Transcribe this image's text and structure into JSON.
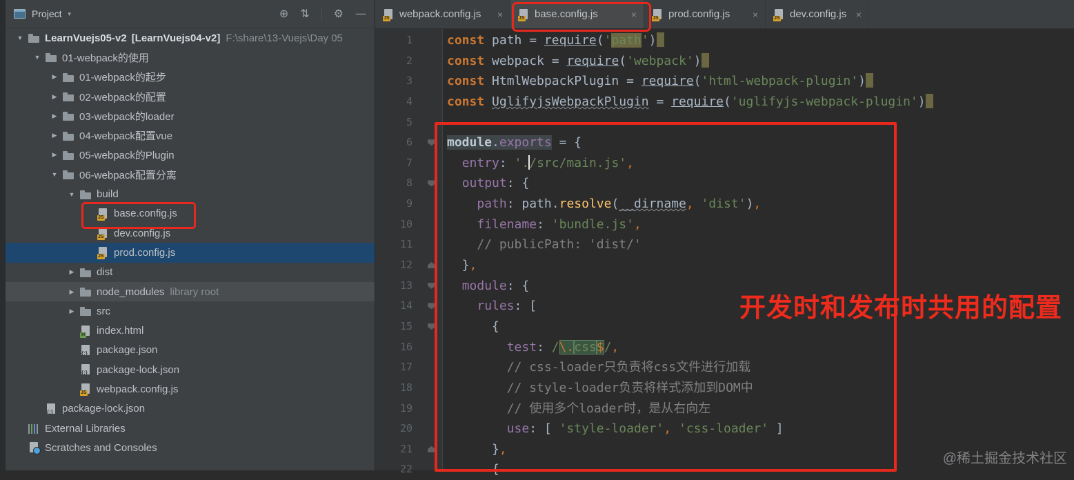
{
  "colors": {
    "annotation_red": "#e7281c",
    "selection_blue": "#1d476f",
    "editor_background": "#2b2b2b",
    "panel_background": "#3d4144",
    "keyword_orange": "#cc7832",
    "string_green": "#6a8759",
    "property_purple": "#9876aa",
    "comment_gray": "#808080"
  },
  "project_panel": {
    "header": {
      "title": "Project",
      "caret": "▼",
      "icons": [
        {
          "name": "locate-icon",
          "glyph": "⊕"
        },
        {
          "name": "collapse-all-icon",
          "glyph": "⇅"
        },
        {
          "name": "separator",
          "glyph": ""
        },
        {
          "name": "settings-gear-icon",
          "glyph": "⚙"
        },
        {
          "name": "hide-panel-icon",
          "glyph": "—"
        }
      ]
    },
    "tree": [
      {
        "id": "root",
        "level": 0,
        "arrow": "open",
        "icon": "folder",
        "label": "LearnVuejs05-v2",
        "bold": true,
        "bracket": "[LearnVuejs04-v2]",
        "note": "F:\\share\\13-Vuejs\\Day 05"
      },
      {
        "id": "folder-01-usage",
        "level": 1,
        "arrow": "open",
        "icon": "folder",
        "label": "01-webpack的使用"
      },
      {
        "id": "folder-01-start",
        "level": 2,
        "arrow": "closed",
        "icon": "folder",
        "label": "01-webpack的起步"
      },
      {
        "id": "folder-02-config",
        "level": 2,
        "arrow": "closed",
        "icon": "folder",
        "label": "02-webpack的配置"
      },
      {
        "id": "folder-03-loader",
        "level": 2,
        "arrow": "closed",
        "icon": "folder",
        "label": "03-webpack的loader"
      },
      {
        "id": "folder-04-vue",
        "level": 2,
        "arrow": "closed",
        "icon": "folder",
        "label": "04-webpack配置vue"
      },
      {
        "id": "folder-05-plugin",
        "level": 2,
        "arrow": "closed",
        "icon": "folder",
        "label": "05-webpack的Plugin"
      },
      {
        "id": "folder-06-split",
        "level": 2,
        "arrow": "open",
        "icon": "folder",
        "label": "06-webpack配置分离"
      },
      {
        "id": "build",
        "level": 3,
        "arrow": "open",
        "icon": "folder",
        "label": "build"
      },
      {
        "id": "base-config-js",
        "level": 4,
        "arrow": "",
        "icon": "jsfile",
        "label": "base.config.js"
      },
      {
        "id": "dev-config-js",
        "level": 4,
        "arrow": "",
        "icon": "jsfile",
        "label": "dev.config.js"
      },
      {
        "id": "prod-config-js",
        "level": 4,
        "arrow": "",
        "icon": "jsfile",
        "label": "prod.config.js",
        "state": "selected"
      },
      {
        "id": "dist",
        "level": 3,
        "arrow": "closed",
        "icon": "folder",
        "label": "dist"
      },
      {
        "id": "node-modules",
        "level": 3,
        "arrow": "closed",
        "icon": "folder",
        "label": "node_modules",
        "note": "library root",
        "state": "hovered"
      },
      {
        "id": "src",
        "level": 3,
        "arrow": "closed",
        "icon": "folder",
        "label": "src"
      },
      {
        "id": "index-html",
        "level": 3,
        "arrow": "",
        "icon": "htmlfile",
        "label": "index.html"
      },
      {
        "id": "package-json",
        "level": 3,
        "arrow": "",
        "icon": "jsonfile",
        "label": "package.json"
      },
      {
        "id": "package-lock-json",
        "level": 3,
        "arrow": "",
        "icon": "jsonfile",
        "label": "package-lock.json"
      },
      {
        "id": "webpack-config-js",
        "level": 3,
        "arrow": "",
        "icon": "jsfile",
        "label": "webpack.config.js"
      },
      {
        "id": "package-lock-json-root",
        "level": 1,
        "arrow": "",
        "icon": "jsonfile",
        "label": "package-lock.json"
      },
      {
        "id": "external-libraries",
        "level": 0,
        "arrow": "",
        "icon": "libs",
        "label": "External Libraries"
      },
      {
        "id": "scratches-and-consoles",
        "level": 0,
        "arrow": "",
        "icon": "scratch",
        "label": "Scratches and Consoles"
      }
    ]
  },
  "editor": {
    "tabs": [
      {
        "id": "webpack-config-js",
        "label": "webpack.config.js",
        "close": "×"
      },
      {
        "id": "base-config-js",
        "label": "base.config.js",
        "close": "×",
        "active": true
      },
      {
        "id": "prod-config-js",
        "label": "prod.config.js",
        "close": "×"
      },
      {
        "id": "dev-config-js",
        "label": "dev.config.js",
        "close": "×"
      }
    ],
    "lines": [
      {
        "n": 1,
        "tokens": [
          {
            "t": "const ",
            "c": "k"
          },
          {
            "t": "path ",
            "c": "v"
          },
          {
            "t": "= ",
            "c": "v"
          },
          {
            "t": "require",
            "c": "v u"
          },
          {
            "t": "(",
            "c": "v"
          },
          {
            "t": "'",
            "c": "s"
          },
          {
            "t": "path",
            "c": "s h"
          },
          {
            "t": "'",
            "c": "s"
          },
          {
            "t": ")",
            "c": "v"
          },
          {
            "t": "",
            "c": "b"
          }
        ]
      },
      {
        "n": 2,
        "tokens": [
          {
            "t": "const ",
            "c": "k"
          },
          {
            "t": "webpack ",
            "c": "v"
          },
          {
            "t": "= ",
            "c": "v"
          },
          {
            "t": "require",
            "c": "v u"
          },
          {
            "t": "(",
            "c": "v"
          },
          {
            "t": "'webpack'",
            "c": "s"
          },
          {
            "t": ")",
            "c": "v"
          },
          {
            "t": "",
            "c": "b"
          }
        ]
      },
      {
        "n": 3,
        "tokens": [
          {
            "t": "const ",
            "c": "k"
          },
          {
            "t": "HtmlWebpackPlugin ",
            "c": "v"
          },
          {
            "t": "= ",
            "c": "v"
          },
          {
            "t": "require",
            "c": "v u"
          },
          {
            "t": "(",
            "c": "v"
          },
          {
            "t": "'html-webpack-plugin'",
            "c": "s"
          },
          {
            "t": ")",
            "c": "v"
          },
          {
            "t": "",
            "c": "b"
          }
        ]
      },
      {
        "n": 4,
        "tokens": [
          {
            "t": "const ",
            "c": "k"
          },
          {
            "t": "UglifyjsWebpackPlugin",
            "c": "v q"
          },
          {
            "t": " = ",
            "c": "v"
          },
          {
            "t": "require",
            "c": "v u"
          },
          {
            "t": "(",
            "c": "v"
          },
          {
            "t": "'uglifyjs-webpack-plugin'",
            "c": "s"
          },
          {
            "t": ")",
            "c": "v"
          },
          {
            "t": "",
            "c": "b"
          }
        ]
      },
      {
        "n": 5,
        "tokens": []
      },
      {
        "n": 6,
        "fold": "open",
        "tokens": [
          {
            "t": "module",
            "c": "w h2"
          },
          {
            "t": ".",
            "c": "v h2"
          },
          {
            "t": "exports",
            "c": "p h2"
          },
          {
            "t": " = {",
            "c": "v"
          }
        ]
      },
      {
        "n": 7,
        "tokens": [
          {
            "t": "  ",
            "c": "v"
          },
          {
            "t": "entry",
            "c": "p"
          },
          {
            "t": ": ",
            "c": "v"
          },
          {
            "t": "'.",
            "c": "s"
          },
          {
            "t": "",
            "c": "caret"
          },
          {
            "t": "/src/main.js'",
            "c": "s"
          },
          {
            "t": ",",
            "c": "o"
          }
        ]
      },
      {
        "n": 8,
        "fold": "open",
        "tokens": [
          {
            "t": "  ",
            "c": "v"
          },
          {
            "t": "output",
            "c": "p"
          },
          {
            "t": ": {",
            "c": "v"
          }
        ]
      },
      {
        "n": 9,
        "tokens": [
          {
            "t": "    ",
            "c": "v"
          },
          {
            "t": "path",
            "c": "p"
          },
          {
            "t": ": ",
            "c": "v"
          },
          {
            "t": "path",
            "c": "v"
          },
          {
            "t": ".",
            "c": "v"
          },
          {
            "t": "resolve",
            "c": "f"
          },
          {
            "t": "(",
            "c": "v"
          },
          {
            "t": "__dirname",
            "c": "v q"
          },
          {
            "t": ",",
            "c": "o"
          },
          {
            "t": " ",
            "c": "v"
          },
          {
            "t": "'dist'",
            "c": "s"
          },
          {
            "t": ")",
            "c": "v"
          },
          {
            "t": ",",
            "c": "o"
          }
        ]
      },
      {
        "n": 10,
        "tokens": [
          {
            "t": "    ",
            "c": "v"
          },
          {
            "t": "filename",
            "c": "p"
          },
          {
            "t": ": ",
            "c": "v"
          },
          {
            "t": "'bundle.js'",
            "c": "s"
          },
          {
            "t": ",",
            "c": "o"
          }
        ]
      },
      {
        "n": 11,
        "tokens": [
          {
            "t": "    ",
            "c": "v"
          },
          {
            "t": "// publicPath: 'dist/'",
            "c": "c"
          }
        ]
      },
      {
        "n": 12,
        "fold": "close",
        "tokens": [
          {
            "t": "  }",
            "c": "v"
          },
          {
            "t": ",",
            "c": "o"
          }
        ]
      },
      {
        "n": 13,
        "fold": "open",
        "tokens": [
          {
            "t": "  ",
            "c": "v"
          },
          {
            "t": "module",
            "c": "p"
          },
          {
            "t": ": {",
            "c": "v"
          }
        ]
      },
      {
        "n": 14,
        "fold": "open",
        "tokens": [
          {
            "t": "    ",
            "c": "v"
          },
          {
            "t": "rules",
            "c": "p"
          },
          {
            "t": ": [",
            "c": "v"
          }
        ]
      },
      {
        "n": 15,
        "fold": "open",
        "tokens": [
          {
            "t": "      {",
            "c": "v"
          }
        ]
      },
      {
        "n": 16,
        "tokens": [
          {
            "t": "        ",
            "c": "v"
          },
          {
            "t": "test",
            "c": "p"
          },
          {
            "t": ": ",
            "c": "v"
          },
          {
            "t": "/",
            "c": "s"
          },
          {
            "t": "\\.",
            "c": "o g"
          },
          {
            "t": "css",
            "c": "s g"
          },
          {
            "t": "$",
            "c": "o g"
          },
          {
            "t": "/",
            "c": "s"
          },
          {
            "t": ",",
            "c": "o"
          }
        ]
      },
      {
        "n": 17,
        "tokens": [
          {
            "t": "        ",
            "c": "v"
          },
          {
            "t": "// css-loader只负责将css文件进行加载",
            "c": "c"
          }
        ]
      },
      {
        "n": 18,
        "tokens": [
          {
            "t": "        ",
            "c": "v"
          },
          {
            "t": "// style-loader负责将样式添加到DOM中",
            "c": "c"
          }
        ]
      },
      {
        "n": 19,
        "tokens": [
          {
            "t": "        ",
            "c": "v"
          },
          {
            "t": "// 使用多个loader时，是从右向左",
            "c": "c"
          }
        ]
      },
      {
        "n": 20,
        "tokens": [
          {
            "t": "        ",
            "c": "v"
          },
          {
            "t": "use",
            "c": "p"
          },
          {
            "t": ": [ ",
            "c": "v"
          },
          {
            "t": "'style-loader'",
            "c": "s"
          },
          {
            "t": ",",
            "c": "o"
          },
          {
            "t": " ",
            "c": "v"
          },
          {
            "t": "'css-loader'",
            "c": "s"
          },
          {
            "t": " ]",
            "c": "v"
          }
        ]
      },
      {
        "n": 21,
        "fold": "close",
        "tokens": [
          {
            "t": "      }",
            "c": "v"
          },
          {
            "t": ",",
            "c": "o"
          }
        ]
      },
      {
        "n": 22,
        "tokens": [
          {
            "t": "      {",
            "c": "v"
          }
        ]
      }
    ]
  },
  "annotations": {
    "note": "开发时和发布时共用的配置",
    "watermark": "@稀土掘金技术社区"
  }
}
